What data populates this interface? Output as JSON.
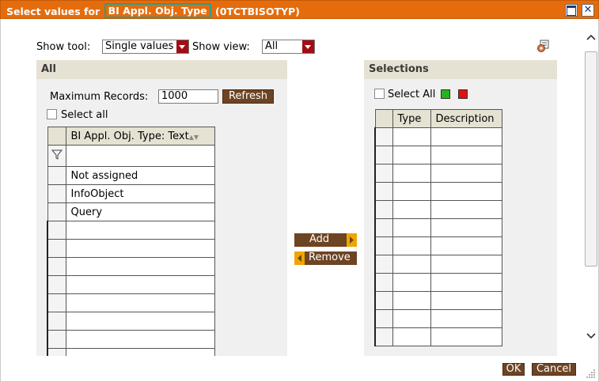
{
  "title": {
    "prefix": "Select values for",
    "highlight": "BI Appl. Obj. Type",
    "suffix": "(0TCTBISOTYP)"
  },
  "options": {
    "show_tool_label": "Show tool:",
    "show_tool_value": "Single values",
    "show_view_label": "Show view:",
    "show_view_value": "All"
  },
  "left_panel": {
    "title": "All",
    "max_records_label": "Maximum Records:",
    "max_records_value": "1000",
    "refresh_label": "Refresh",
    "select_all_label": "Select all",
    "column_header": "BI Appl. Obj. Type: Text",
    "rows": [
      "Not assigned",
      "InfoObject",
      "Query"
    ]
  },
  "middle": {
    "add_label": "Add",
    "remove_label": "Remove"
  },
  "right_panel": {
    "title": "Selections",
    "select_all_label": "Select All",
    "col_type": "Type",
    "col_description": "Description"
  },
  "footer": {
    "ok_label": "OK",
    "cancel_label": "Cancel"
  },
  "colors": {
    "titlebar": "#e56c0c",
    "brown_button": "#6d4424",
    "green_square": "#22b41a",
    "red_square": "#e01010"
  }
}
